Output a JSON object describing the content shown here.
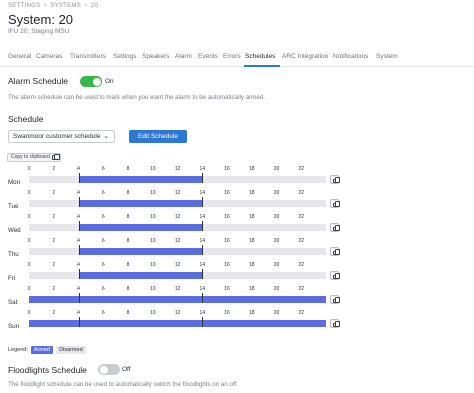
{
  "breadcrumb": [
    "SETTINGS",
    "SYSTEMS",
    "20"
  ],
  "breadcrumb_separator": ">",
  "title": "System: 20",
  "subtitle": "IFU 20: Staging MSU",
  "tabs": [
    {
      "label": "General",
      "active": false
    },
    {
      "label": "Cameras",
      "active": false
    },
    {
      "label": "Transmitters",
      "active": false
    },
    {
      "label": "Settings",
      "active": false
    },
    {
      "label": "Speakers",
      "active": false
    },
    {
      "label": "Alarm",
      "active": false
    },
    {
      "label": "Events",
      "active": false
    },
    {
      "label": "Errors",
      "active": false
    },
    {
      "label": "Schedules",
      "active": true
    },
    {
      "label": "ARC Integration",
      "active": false
    },
    {
      "label": "Notifications",
      "active": false
    },
    {
      "label": "System",
      "active": false
    }
  ],
  "alarm_schedule": {
    "title": "Alarm Schedule",
    "toggle_state": "On",
    "enabled": true,
    "description": "The alarm schedule can be used to mark when you want the alarm to be automatically armed."
  },
  "schedule": {
    "title": "Schedule",
    "selected": "Swanmoor customer schedule",
    "edit_label": "Edit Schedule",
    "copy_label": "Copy to clipboard"
  },
  "hour_ticks": [
    "0",
    "2",
    "4",
    "6",
    "8",
    "10",
    "12",
    "14",
    "16",
    "18",
    "20",
    "22"
  ],
  "days": [
    {
      "label": "Mon",
      "armed": [
        [
          4,
          14
        ]
      ]
    },
    {
      "label": "Tue",
      "armed": [
        [
          4,
          14
        ]
      ]
    },
    {
      "label": "Wed",
      "armed": [
        [
          4,
          14
        ]
      ]
    },
    {
      "label": "Thu",
      "armed": [
        [
          4,
          14
        ]
      ]
    },
    {
      "label": "Fri",
      "armed": [
        [
          4,
          14
        ]
      ]
    },
    {
      "label": "Sat",
      "armed": [
        [
          0,
          24
        ]
      ]
    },
    {
      "label": "Sun",
      "armed": [
        [
          0,
          24
        ]
      ]
    }
  ],
  "legend": {
    "label": "Legend:",
    "armed": "Armed",
    "disarmed": "Disarmed"
  },
  "floodlights_schedule": {
    "title": "Floodlights Schedule",
    "toggle_state": "Off",
    "enabled": false,
    "description": "The floodlight schedule can be used to automatically switch the floodlights on an off."
  },
  "colors": {
    "accent": "#2c78d4",
    "armed": "#5b6ee1",
    "disarmed": "#e5e7ea",
    "toggle_on": "#39b54a",
    "toggle_off": "#c8ccd1"
  }
}
